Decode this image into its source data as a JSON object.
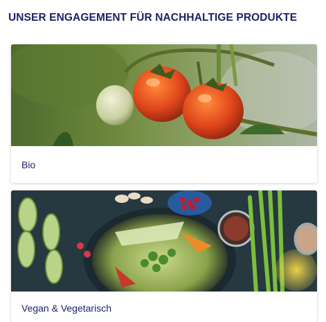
{
  "section": {
    "title": "UNSER ENGAGEMENT FÜR NACHHALTIGE PRODUKTE"
  },
  "cards": [
    {
      "label": "Bio",
      "image": "tomatoes-on-vine-photo"
    },
    {
      "label": "Vegan & Vegetarisch",
      "image": "vegetable-bowl-flatlay-photo"
    }
  ],
  "colors": {
    "title": "#1e2266",
    "card_bg": "#ffffff"
  }
}
